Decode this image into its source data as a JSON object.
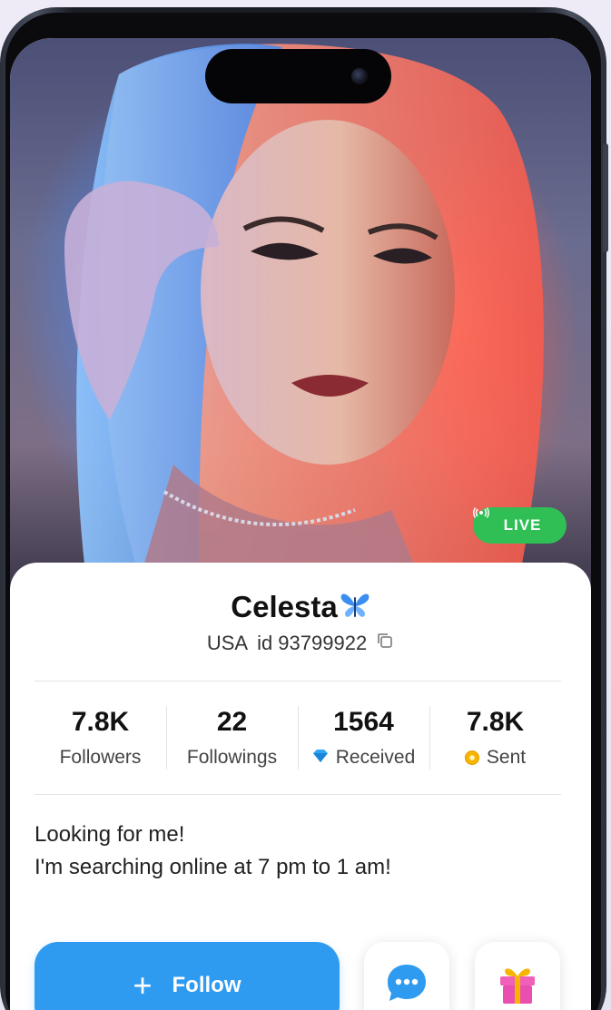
{
  "profile": {
    "name": "Celesta",
    "country": "USA",
    "id_text": "id 93799922",
    "live_label": "LIVE"
  },
  "stats": [
    {
      "value": "7.8K",
      "label": "Followers"
    },
    {
      "value": "22",
      "label": "Followings"
    },
    {
      "value": "1564",
      "label": "Received",
      "icon": "diamond-icon"
    },
    {
      "value": "7.8K",
      "label": "Sent",
      "icon": "coin-icon"
    }
  ],
  "bio": {
    "line1": "Looking for me!",
    "line2": "I'm searching online at 7 pm to 1 am!"
  },
  "actions": {
    "follow_label": "Follow",
    "message_icon": "chat-bubble-icon",
    "gift_icon": "gift-icon"
  },
  "colors": {
    "accent": "#2e9bf0",
    "live": "#2fbf54",
    "gift": "#e84fb0"
  }
}
